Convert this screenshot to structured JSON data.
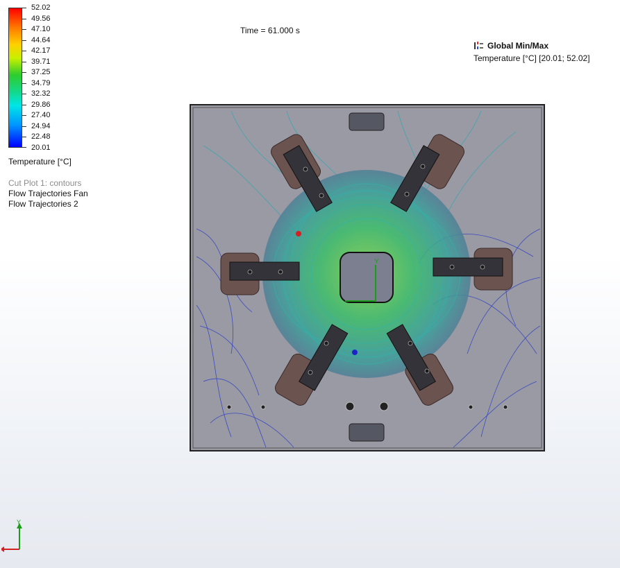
{
  "legend": {
    "ticks": [
      "52.02",
      "49.56",
      "47.10",
      "44.64",
      "42.17",
      "39.71",
      "37.25",
      "34.79",
      "32.32",
      "29.86",
      "27.40",
      "24.94",
      "22.48",
      "20.01"
    ],
    "title": "Temperature [°C]",
    "colors": [
      "#ff0000",
      "#ff7a00",
      "#ffd000",
      "#c8f000",
      "#2ecc2e",
      "#14d888",
      "#00e6e6",
      "#0096ff",
      "#0000ff"
    ]
  },
  "plots": {
    "cut_plot": "Cut Plot 1: contours",
    "trajectories": [
      "Flow Trajectories Fan",
      "Flow Trajectories 2"
    ]
  },
  "time_label": "Time = 61.000 s",
  "global_minmax": {
    "title": "Global Min/Max",
    "value": "Temperature [°C] [20.01; 52.02]"
  },
  "model_axes": {
    "y": "Y"
  },
  "triad": {
    "y": "Y"
  },
  "icons": [
    "min-max-icon",
    "triad-icon"
  ]
}
